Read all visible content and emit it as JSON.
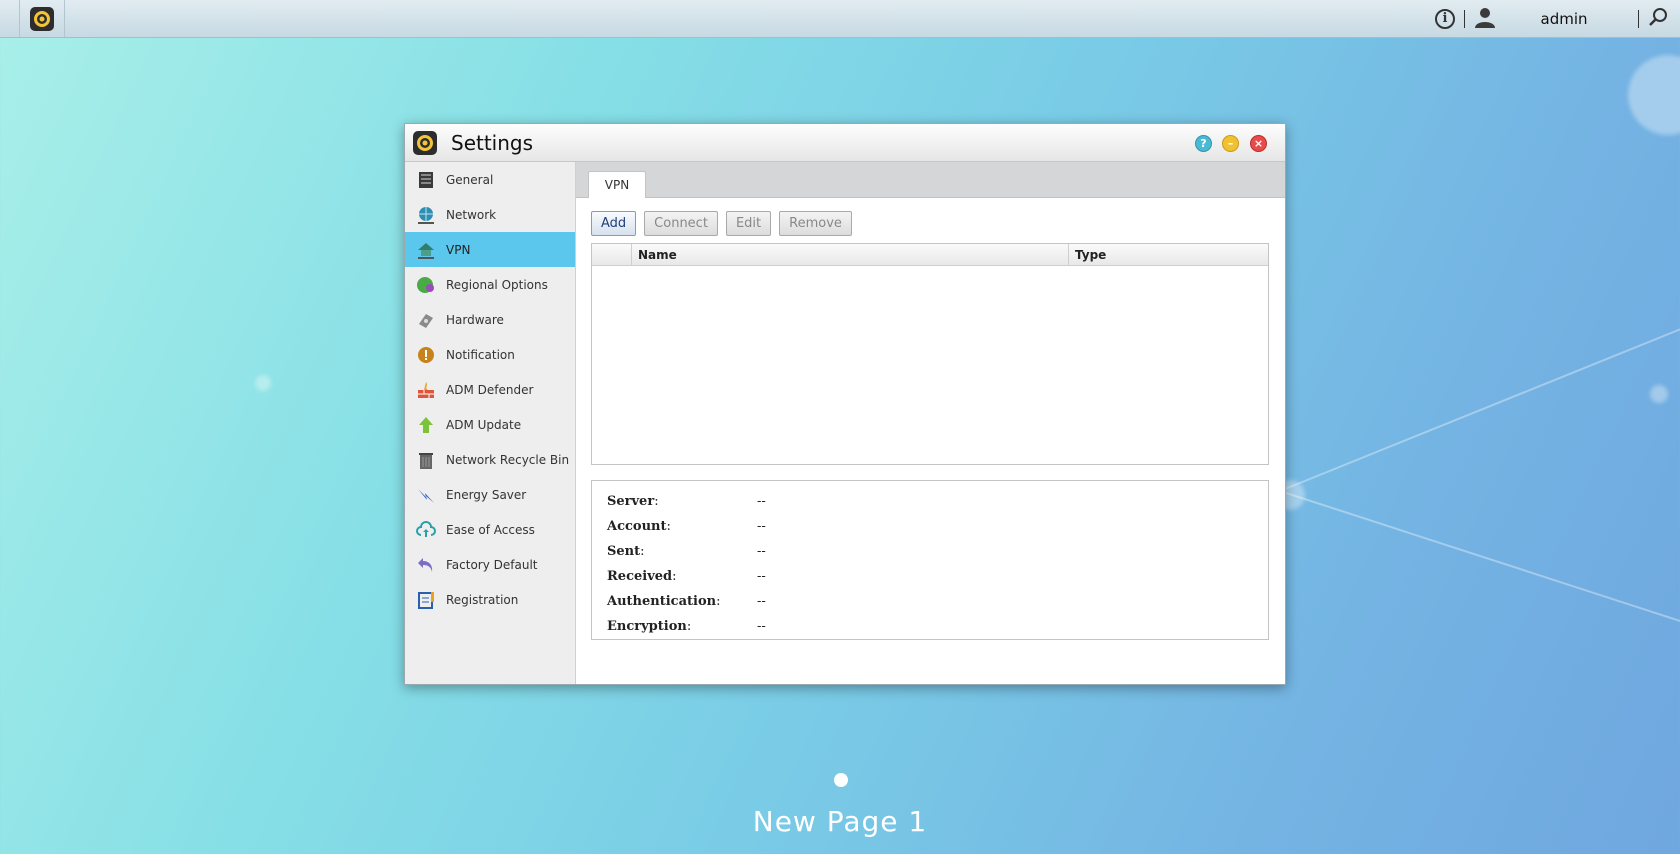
{
  "taskbar": {
    "app_icon": "settings-gear-icon",
    "info_icon": "info-icon",
    "user_icon": "user-icon",
    "username": "admin",
    "search_icon": "search-icon"
  },
  "window": {
    "title": "Settings",
    "controls": [
      "help",
      "minimize",
      "close"
    ]
  },
  "sidebar": {
    "items": [
      {
        "label": "General",
        "icon": "general-icon",
        "active": false
      },
      {
        "label": "Network",
        "icon": "network-icon",
        "active": false
      },
      {
        "label": "VPN",
        "icon": "vpn-icon",
        "active": true
      },
      {
        "label": "Regional Options",
        "icon": "regional-options-icon",
        "active": false
      },
      {
        "label": "Hardware",
        "icon": "hardware-icon",
        "active": false
      },
      {
        "label": "Notification",
        "icon": "notification-icon",
        "active": false
      },
      {
        "label": "ADM Defender",
        "icon": "firewall-icon",
        "active": false
      },
      {
        "label": "ADM Update",
        "icon": "update-arrow-icon",
        "active": false
      },
      {
        "label": "Network Recycle Bin",
        "icon": "recycle-bin-icon",
        "active": false
      },
      {
        "label": "Energy Saver",
        "icon": "energy-saver-icon",
        "active": false
      },
      {
        "label": "Ease of Access",
        "icon": "cloud-upload-icon",
        "active": false
      },
      {
        "label": "Factory Default",
        "icon": "undo-arrow-icon",
        "active": false
      },
      {
        "label": "Registration",
        "icon": "registration-icon",
        "active": false
      }
    ]
  },
  "content": {
    "tab": "VPN",
    "toolbar": {
      "add": "Add",
      "connect": "Connect",
      "edit": "Edit",
      "remove": "Remove"
    },
    "table": {
      "columns": [
        "Name",
        "Type"
      ],
      "rows": []
    },
    "details": [
      {
        "label": "Server",
        "value": "--"
      },
      {
        "label": "Account",
        "value": "--"
      },
      {
        "label": "Sent",
        "value": "--"
      },
      {
        "label": "Received",
        "value": "--"
      },
      {
        "label": "Authentication",
        "value": "--"
      },
      {
        "label": "Encryption",
        "value": "--"
      }
    ]
  },
  "desktop": {
    "page_name": "New Page 1"
  },
  "colors": {
    "active_item": "#5bc7ec",
    "help": "#4ab9d3",
    "minimize": "#f0c233",
    "close": "#e74b4b"
  }
}
